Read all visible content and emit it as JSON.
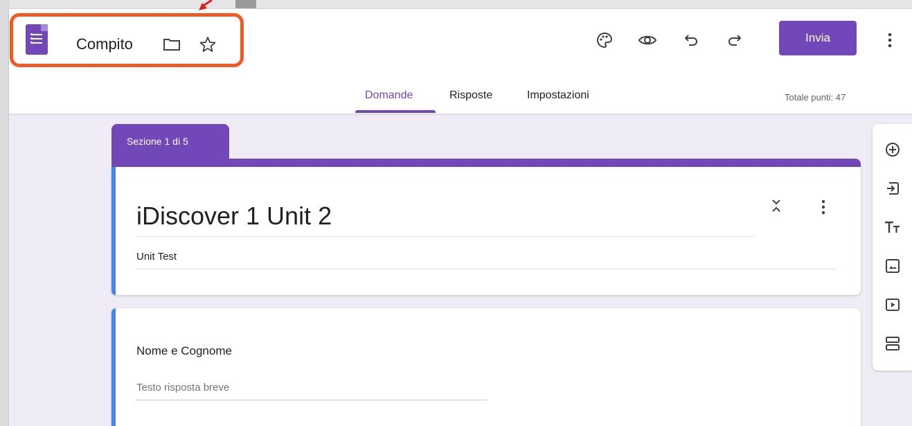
{
  "app": {
    "doc_title": "Compito"
  },
  "header": {
    "send_label": "Invia",
    "icons": [
      "palette-icon",
      "eye-icon",
      "undo-icon",
      "redo-icon",
      "more-vert-icon"
    ]
  },
  "tabs": [
    {
      "label": "Domande",
      "active": true
    },
    {
      "label": "Risposte",
      "active": false
    },
    {
      "label": "Impostazioni",
      "active": false
    }
  ],
  "points_label": "Totale punti: 47",
  "section": {
    "label": "Sezione 1 di 5"
  },
  "form": {
    "title": "iDiscover 1 Unit 2",
    "description": "Unit Test"
  },
  "question": {
    "title": "Nome e Cognome",
    "placeholder": "Testo risposta breve"
  },
  "toolbar": {
    "icons": [
      "add-question-icon",
      "import-questions-icon",
      "add-title-icon",
      "add-image-icon",
      "add-video-icon",
      "add-section-icon"
    ]
  },
  "colors": {
    "accent": "#7248b9",
    "highlight": "#f15a22",
    "card_accent": "#4285f4",
    "background": "#efecf6"
  }
}
